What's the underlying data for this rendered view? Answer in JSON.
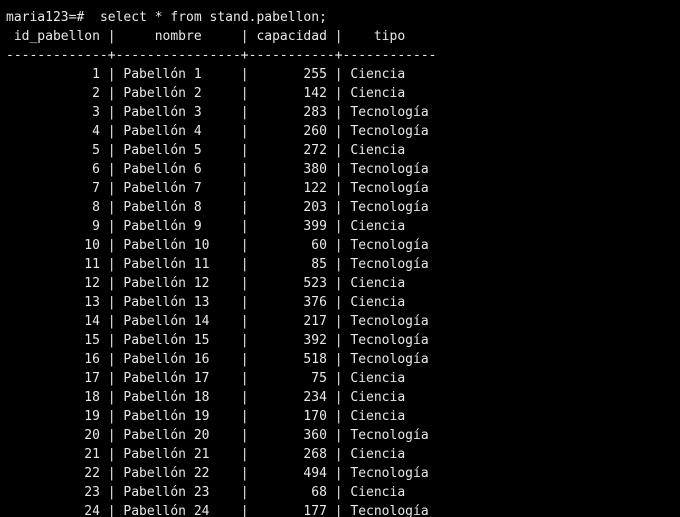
{
  "terminal": {
    "prompt": "maria123=#",
    "command": "select * from stand.pabellon;",
    "header": " id_pabellon |     nombre     | capacidad |    tipo",
    "separator": "-------------+----------------+-----------+------------",
    "rows": [
      "           1 | Pabellón 1     |       255 | Ciencia",
      "           2 | Pabellón 2     |       142 | Ciencia",
      "           3 | Pabellón 3     |       283 | Tecnología",
      "           4 | Pabellón 4     |       260 | Tecnología",
      "           5 | Pabellón 5     |       272 | Ciencia",
      "           6 | Pabellón 6     |       380 | Tecnología",
      "           7 | Pabellón 7     |       122 | Tecnología",
      "           8 | Pabellón 8     |       203 | Tecnología",
      "           9 | Pabellón 9     |       399 | Ciencia",
      "          10 | Pabellón 10    |        60 | Tecnología",
      "          11 | Pabellón 11    |        85 | Tecnología",
      "          12 | Pabellón 12    |       523 | Ciencia",
      "          13 | Pabellón 13    |       376 | Ciencia",
      "          14 | Pabellón 14    |       217 | Tecnología",
      "          15 | Pabellón 15    |       392 | Tecnología",
      "          16 | Pabellón 16    |       518 | Tecnología",
      "          17 | Pabellón 17    |        75 | Ciencia",
      "          18 | Pabellón 18    |       234 | Ciencia",
      "          19 | Pabellón 19    |       170 | Ciencia",
      "          20 | Pabellón 20    |       360 | Tecnología",
      "          21 | Pabellón 21    |       268 | Ciencia",
      "          22 | Pabellón 22    |       494 | Tecnología",
      "          23 | Pabellón 23    |        68 | Ciencia",
      "          24 | Pabellón 24    |       177 | Tecnología"
    ]
  }
}
